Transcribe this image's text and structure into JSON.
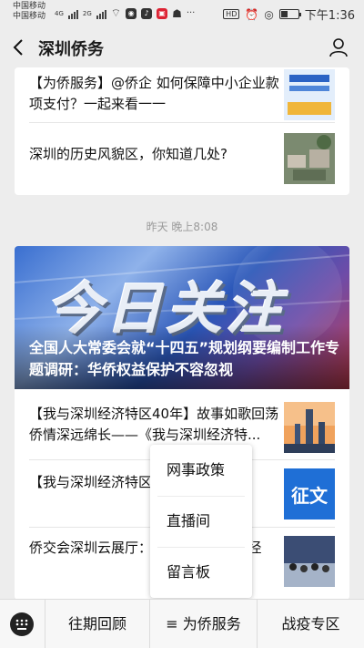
{
  "status_bar": {
    "carrier_1": "中国移动",
    "carrier_2": "中国移动",
    "network_1": "4G",
    "network_2": "2G",
    "hd": "HD",
    "time": "下午1:36"
  },
  "header": {
    "title": "深圳侨务"
  },
  "card1": {
    "items": [
      {
        "text": "【为侨服务】@侨企 如何保障中小企业款项支付？一起来看一一"
      },
      {
        "text": "深圳的历史风貌区，你知道几处?"
      }
    ]
  },
  "timestamp": "昨天 晚上8:08",
  "card2": {
    "banner_big_text": "今日关注",
    "banner_title": "全国人大常委会就“十四五”规划纲要编制工作专题调研：华侨权益保护不容忽视",
    "items": [
      {
        "text": "【我与深圳经济特区40年】故事如歌回荡 侨情深远绵长——《我与深圳经济特..."
      },
      {
        "text": "【我与深圳经济特区4…人在新西兰"
      },
      {
        "text": "侨交会深圳云展厅：…业”出海”新路径"
      }
    ]
  },
  "popup_menu": {
    "items": [
      "网事政策",
      "直播间",
      "留言板"
    ]
  },
  "bottom_menu": {
    "items": [
      "往期回顾",
      "≡ 为侨服务",
      "战疫专区"
    ]
  },
  "colors": {
    "background": "#ededed",
    "card": "#ffffff",
    "timestamp": "#9a9a9a"
  },
  "thumb4_text": "征文"
}
